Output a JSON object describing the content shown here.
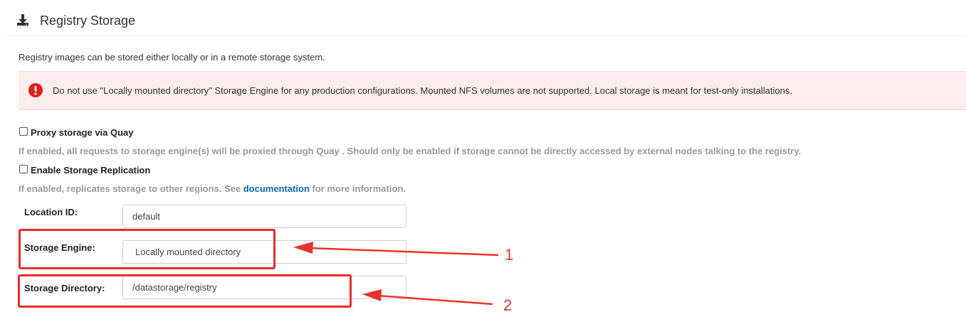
{
  "header": {
    "title": "Registry Storage",
    "icon": "download-icon"
  },
  "description": "Registry images can be stored either locally or in a remote storage system.",
  "alert": {
    "icon": "exclamation-circle-icon",
    "text": "Do not use \"Locally mounted directory\" Storage Engine for any production configurations. Mounted NFS volumes are not supported. Local storage is meant for test-only installations."
  },
  "options": {
    "proxy": {
      "label": "Proxy storage via Quay",
      "checked": false,
      "help": "If enabled, all requests to storage engine(s) will be proxied through Quay . Should only be enabled if storage cannot be directly accessed by external nodes talking to the registry."
    },
    "replication": {
      "label": "Enable Storage Replication",
      "checked": false,
      "help_prefix": "If enabled, replicates storage to other regions. See",
      "help_link": "documentation",
      "help_suffix": "for more information."
    }
  },
  "fields": {
    "location_id": {
      "label": "Location ID:",
      "value": "default"
    },
    "storage_engine": {
      "label": "Storage Engine:",
      "value": "Locally mounted directory"
    },
    "storage_directory": {
      "label": "Storage Directory:",
      "value": "/datastorage/registry"
    }
  },
  "annotations": {
    "one": "1",
    "two": "2"
  },
  "colors": {
    "alert_bg": "#fdeded",
    "alert_icon": "#d9221c",
    "link": "#0b67b5",
    "annotation": "#e8332c"
  }
}
